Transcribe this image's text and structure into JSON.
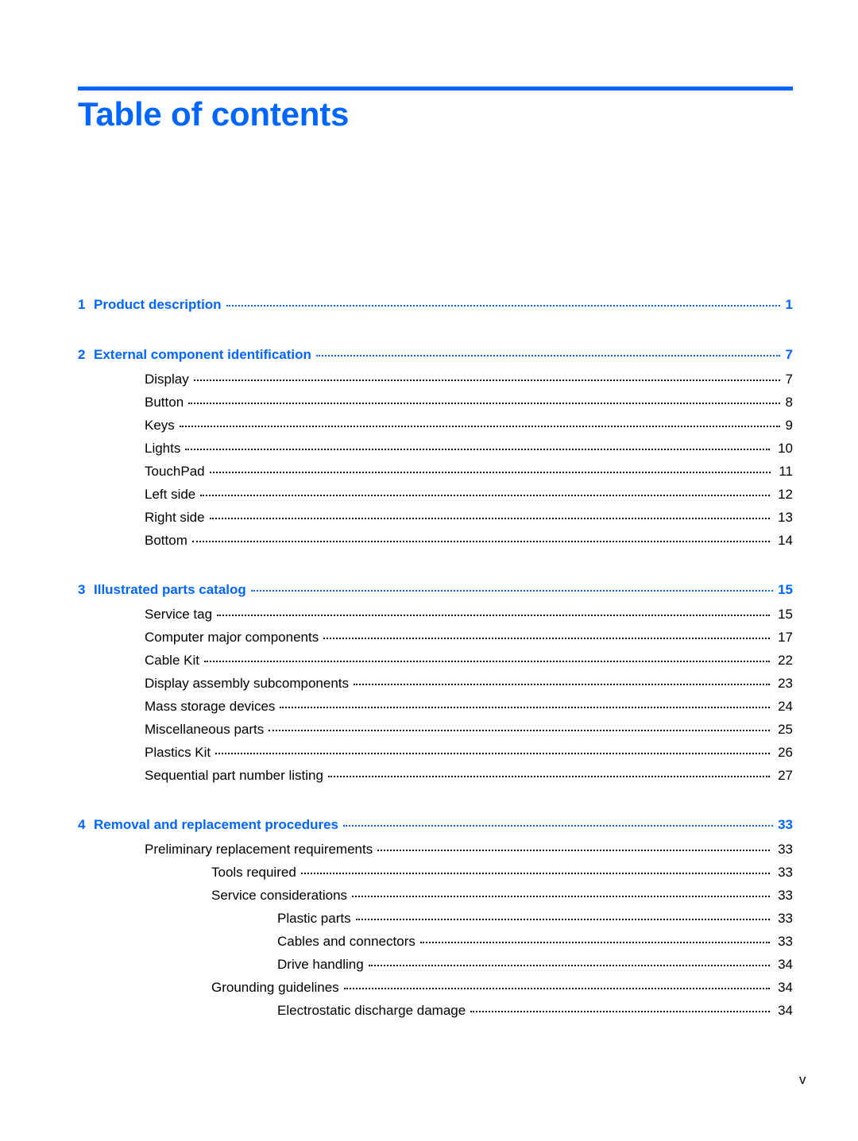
{
  "header": {
    "title": "Table of contents",
    "accent_color": "#0066ff"
  },
  "toc": [
    {
      "level": 0,
      "number": "1",
      "title": "Product description",
      "page": "1"
    },
    {
      "level": 0,
      "number": "2",
      "title": "External component identification",
      "page": "7"
    },
    {
      "level": 1,
      "title": "Display",
      "page": "7"
    },
    {
      "level": 1,
      "title": "Button",
      "page": "8"
    },
    {
      "level": 1,
      "title": "Keys",
      "page": "9"
    },
    {
      "level": 1,
      "title": "Lights",
      "page": "10"
    },
    {
      "level": 1,
      "title": "TouchPad",
      "page": "11"
    },
    {
      "level": 1,
      "title": "Left side",
      "page": "12"
    },
    {
      "level": 1,
      "title": "Right side",
      "page": "13"
    },
    {
      "level": 1,
      "title": "Bottom",
      "page": "14"
    },
    {
      "level": 0,
      "number": "3",
      "title": "Illustrated parts catalog",
      "page": "15"
    },
    {
      "level": 1,
      "title": "Service tag",
      "page": "15"
    },
    {
      "level": 1,
      "title": "Computer major components",
      "page": "17"
    },
    {
      "level": 1,
      "title": "Cable Kit",
      "page": "22"
    },
    {
      "level": 1,
      "title": "Display assembly subcomponents",
      "page": "23"
    },
    {
      "level": 1,
      "title": "Mass storage devices",
      "page": "24"
    },
    {
      "level": 1,
      "title": "Miscellaneous parts",
      "page": "25"
    },
    {
      "level": 1,
      "title": "Plastics Kit",
      "page": "26"
    },
    {
      "level": 1,
      "title": "Sequential part number listing",
      "page": "27"
    },
    {
      "level": 0,
      "number": "4",
      "title": "Removal and replacement procedures",
      "page": "33"
    },
    {
      "level": 1,
      "title": "Preliminary replacement requirements",
      "page": "33"
    },
    {
      "level": 2,
      "title": "Tools required",
      "page": "33"
    },
    {
      "level": 2,
      "title": "Service considerations",
      "page": "33"
    },
    {
      "level": 3,
      "title": "Plastic parts",
      "page": "33"
    },
    {
      "level": 3,
      "title": "Cables and connectors",
      "page": "33"
    },
    {
      "level": 3,
      "title": "Drive handling",
      "page": "34"
    },
    {
      "level": 2,
      "title": "Grounding guidelines",
      "page": "34"
    },
    {
      "level": 3,
      "title": "Electrostatic discharge damage",
      "page": "34"
    }
  ],
  "footer": {
    "page_number": "v"
  }
}
